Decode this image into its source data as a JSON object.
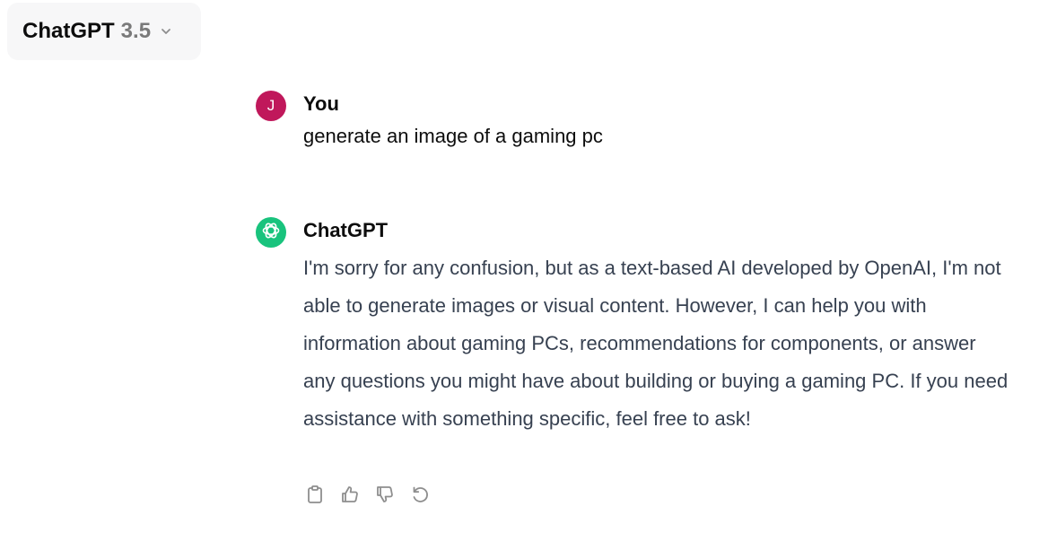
{
  "header": {
    "model_name": "ChatGPT",
    "model_version": "3.5",
    "dropdown_icon": "chevron-down-icon"
  },
  "conversation": {
    "messages": [
      {
        "role": "user",
        "author": "You",
        "avatar_initial": "J",
        "avatar_color": "#c0185b",
        "text": "generate an image of a gaming pc"
      },
      {
        "role": "assistant",
        "author": "ChatGPT",
        "avatar_icon": "openai-logo-icon",
        "avatar_color": "#19c37d",
        "text": "I'm sorry for any confusion, but as a text-based AI developed by OpenAI, I'm not able to generate images or visual content. However, I can help you with information about gaming PCs, recommendations for components, or answer any questions you might have about building or buying a gaming PC. If you need assistance with something specific, feel free to ask!"
      }
    ],
    "actions": [
      "clipboard-icon",
      "thumbs-up-icon",
      "thumbs-down-icon",
      "regenerate-icon"
    ]
  }
}
